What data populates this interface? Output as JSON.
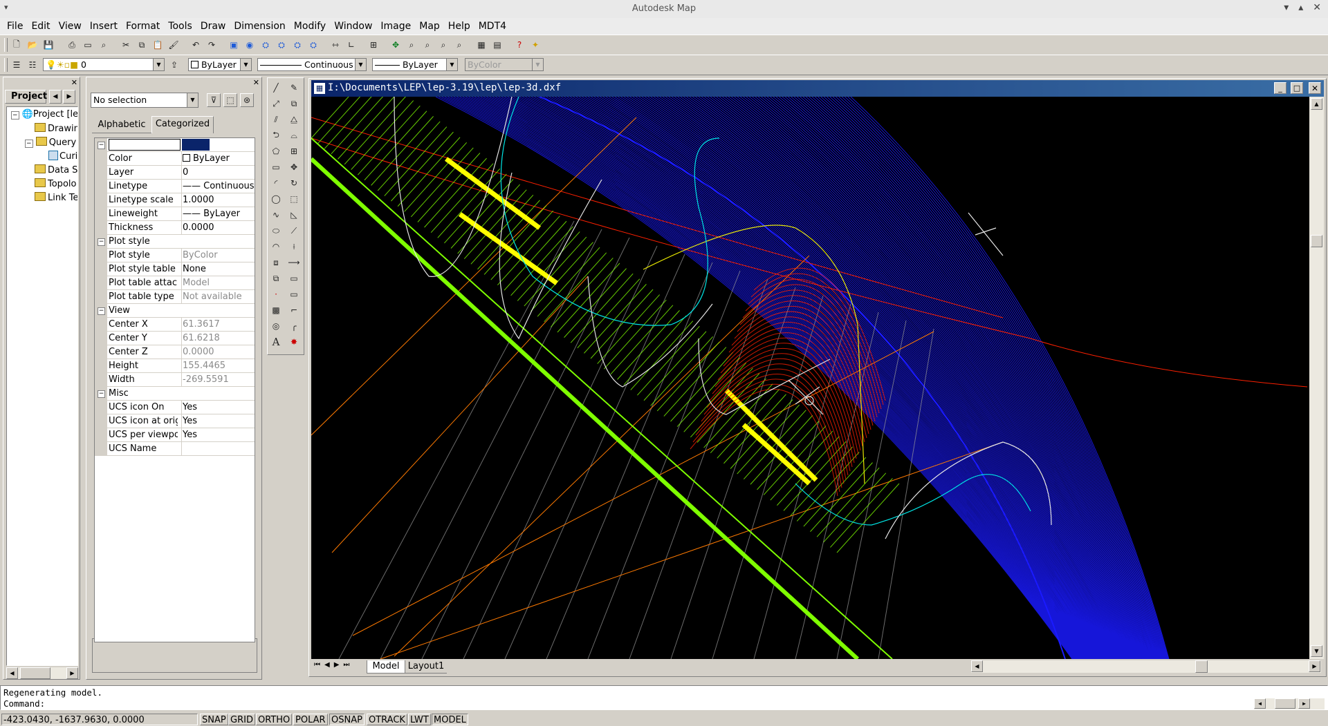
{
  "window": {
    "title": "Autodesk Map"
  },
  "menu": [
    "File",
    "Edit",
    "View",
    "Insert",
    "Format",
    "Tools",
    "Draw",
    "Dimension",
    "Modify",
    "Window",
    "Image",
    "Map",
    "Help",
    "MDT4"
  ],
  "layer_bar": {
    "layer": "0",
    "color": "ByLayer",
    "linetype": "Continuous",
    "lineweight": "ByLayer",
    "plotstyle": "ByColor"
  },
  "project_panel": {
    "tab": "Project",
    "tree": [
      {
        "label": "Project [le",
        "level": 0
      },
      {
        "label": "Drawin",
        "level": 1
      },
      {
        "label": "Query",
        "level": 1
      },
      {
        "label": "Curi",
        "level": 2
      },
      {
        "label": "Data S",
        "level": 1
      },
      {
        "label": "Topolo",
        "level": 1
      },
      {
        "label": "Link Te",
        "level": 1
      }
    ]
  },
  "properties": {
    "selection": "No selection",
    "tabs": [
      "Alphabetic",
      "Categorized"
    ],
    "active_tab": "Categorized",
    "rows": [
      {
        "type": "header",
        "name": ""
      },
      {
        "name": "Color",
        "value": "ByLayer"
      },
      {
        "name": "Layer",
        "value": "0"
      },
      {
        "name": "Linetype",
        "value": "—— Continuous"
      },
      {
        "name": "Linetype scale",
        "value": "1.0000"
      },
      {
        "name": "Lineweight",
        "value": "—— ByLayer"
      },
      {
        "name": "Thickness",
        "value": "0.0000"
      },
      {
        "type": "cat",
        "name": "Plot style"
      },
      {
        "name": "Plot style",
        "value": "ByColor",
        "gray": true
      },
      {
        "name": "Plot style table",
        "value": "None"
      },
      {
        "name": "Plot table attached to",
        "value": "Model",
        "gray": true
      },
      {
        "name": "Plot table type",
        "value": "Not available",
        "gray": true
      },
      {
        "type": "cat",
        "name": "View"
      },
      {
        "name": "Center X",
        "value": "61.3617",
        "gray": true
      },
      {
        "name": "Center Y",
        "value": "61.6218",
        "gray": true
      },
      {
        "name": "Center Z",
        "value": "0.0000",
        "gray": true
      },
      {
        "name": "Height",
        "value": "155.4465",
        "gray": true
      },
      {
        "name": "Width",
        "value": "-269.5591",
        "gray": true
      },
      {
        "type": "cat",
        "name": "Misc"
      },
      {
        "name": "UCS icon On",
        "value": "Yes"
      },
      {
        "name": "UCS icon at origin",
        "value": "Yes"
      },
      {
        "name": "UCS per viewport",
        "value": "Yes"
      },
      {
        "name": "UCS Name",
        "value": ""
      }
    ]
  },
  "drawing": {
    "title": "I:\\Documents\\LEP\\lep-3.19\\lep\\lep-3d.dxf",
    "layout_tabs": [
      "Model",
      "Layout1"
    ],
    "active_layout": "Model",
    "colors": {
      "blue": "#1a1aff",
      "green": "#7fff00",
      "yellow": "#ffff00",
      "red": "#ff2000",
      "cyan": "#00e5e5",
      "white": "#e6e6e6",
      "orange": "#ff7a00",
      "gray": "#9a9a9a"
    }
  },
  "command": {
    "history": "Regenerating model.",
    "prompt": "Command:"
  },
  "status": {
    "coords": "-423.0430, -1637.9630, 0.0000",
    "buttons": [
      "SNAP",
      "GRID",
      "ORTHO",
      "POLAR",
      "OSNAP",
      "OTRACK",
      "LWT",
      "MODEL"
    ]
  }
}
